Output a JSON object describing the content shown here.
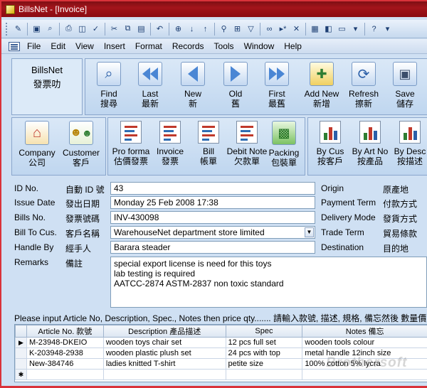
{
  "window": {
    "title": "BillsNet - [Invoice]"
  },
  "menu": [
    "File",
    "Edit",
    "View",
    "Insert",
    "Format",
    "Records",
    "Tools",
    "Window",
    "Help"
  ],
  "brand": {
    "line1": "BillsNet",
    "line2": "發票叻"
  },
  "nav_buttons": [
    {
      "label": "Find",
      "sub": "搜尋",
      "icon": "magnifier-icon"
    },
    {
      "label": "Last",
      "sub": "最新",
      "icon": "rewind-icon"
    },
    {
      "label": "New",
      "sub": "新",
      "icon": "prev-arrow-icon"
    },
    {
      "label": "Old",
      "sub": "舊",
      "icon": "next-arrow-icon"
    },
    {
      "label": "First",
      "sub": "最舊",
      "icon": "fast-forward-icon"
    },
    {
      "label": "Add New",
      "sub": "新增",
      "icon": "add-new-icon"
    },
    {
      "label": "Refresh",
      "sub": "擦新",
      "icon": "refresh-icon"
    },
    {
      "label": "Save",
      "sub": "儲存",
      "icon": "save-icon"
    }
  ],
  "group_a": [
    {
      "label": "Company",
      "sub": "公司",
      "icon": "company-house-icon"
    },
    {
      "label": "Customer",
      "sub": "客戶",
      "icon": "customer-people-icon"
    }
  ],
  "group_b": [
    {
      "label": "Pro forma",
      "sub": "估價發票",
      "icon": "proforma-document-icon"
    },
    {
      "label": "Invoice",
      "sub": "發票",
      "icon": "invoice-document-icon"
    },
    {
      "label": "Bill",
      "sub": "帳單",
      "icon": "bill-document-icon"
    },
    {
      "label": "Debit Note",
      "sub": "欠款單",
      "icon": "debit-note-document-icon"
    },
    {
      "label": "Packing",
      "sub": "包裝單",
      "icon": "packing-boxes-icon"
    }
  ],
  "group_c": [
    {
      "label": "By Cus",
      "sub": "按客戶",
      "icon": "report-chart-icon"
    },
    {
      "label": "By Art No",
      "sub": "按產品",
      "icon": "report-chart-icon"
    },
    {
      "label": "By Desc",
      "sub": "按描述",
      "icon": "report-chart-icon"
    }
  ],
  "form": {
    "id_no": {
      "label": "ID No.",
      "label_zh": "自動 ID 號",
      "value": "43"
    },
    "issue_date": {
      "label": "Issue Date",
      "label_zh": "發出日期",
      "value": "Monday 25 Feb 2008 17:38"
    },
    "bills_no": {
      "label": "Bills No.",
      "label_zh": "發票號碼",
      "value": "INV-430098"
    },
    "bill_to": {
      "label": "Bill To Cus.",
      "label_zh": "客戶名稱",
      "value": "WarehouseNet department store limited"
    },
    "handle_by": {
      "label": "Handle By",
      "label_zh": "經手人",
      "value": "Barara steader"
    },
    "remarks": {
      "label": "Remarks",
      "label_zh": "備註",
      "lines": [
        "special export license is need for this toys",
        "lab testing is required",
        "AATCC-2874  ASTM-2837 non toxic standard"
      ]
    },
    "origin": {
      "label": "Origin",
      "label_zh": "原產地",
      "value": ""
    },
    "payment_term": {
      "label": "Payment Term",
      "label_zh": "付款方式",
      "value": ""
    },
    "delivery_mode": {
      "label": "Delivery Mode",
      "label_zh": "發貨方式",
      "value": ""
    },
    "trade_term": {
      "label": "Trade Term",
      "label_zh": "貿易條款",
      "value": ""
    },
    "destination": {
      "label": "Destination",
      "label_zh": "目的地",
      "value": ""
    }
  },
  "hint": "Please input Article No, Description, Spec., Notes then price qty.......   請輸入款號, 描述, 規格, 備忘然後 數量價",
  "grid": {
    "columns": [
      "Article No. 款號",
      "Description 產品描述",
      "Spec",
      "Notes 備忘"
    ],
    "rows": [
      {
        "selector": "▶",
        "cells": [
          "M-23948-DKEIO",
          "wooden toys chair set",
          "12 pcs full set",
          "wooden tools colour"
        ]
      },
      {
        "selector": "",
        "cells": [
          "K-203948-2938",
          "wooden plastic plush set",
          "24 pcs with top",
          "metal handle 12inch size"
        ]
      },
      {
        "selector": "",
        "cells": [
          "New-384746",
          "ladies knitted T-shirt",
          "petite size",
          "100% cotton 5% lycra"
        ]
      },
      {
        "selector": "✱",
        "cells": [
          "",
          "",
          "",
          ""
        ]
      }
    ]
  },
  "watermark": "Brothersoft"
}
